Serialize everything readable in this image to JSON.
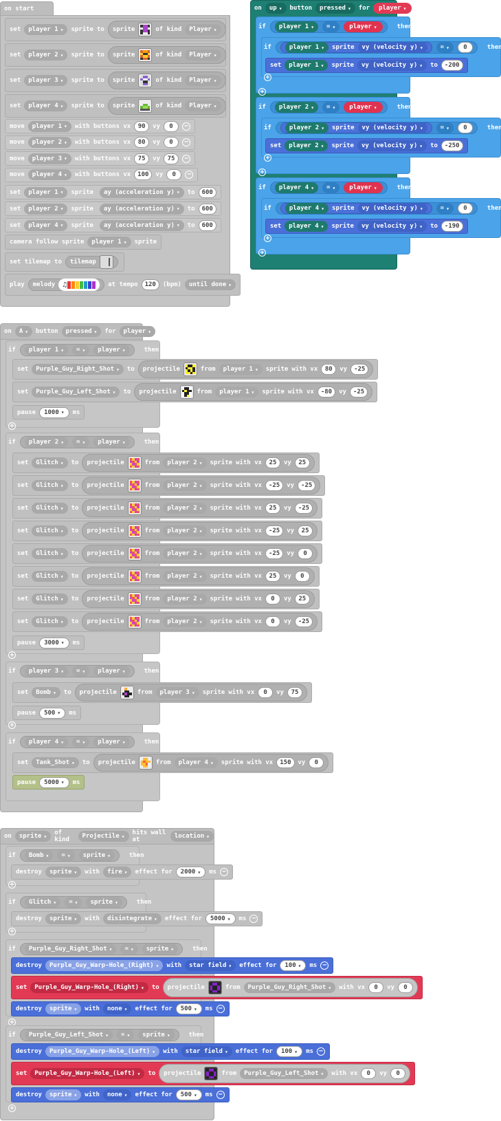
{
  "kw": {
    "set": "set",
    "sprite": "sprite",
    "to": "to",
    "of_kind": "of kind",
    "move": "move",
    "with_buttons_vx": "with buttons vx",
    "vy": "vy",
    "camera_follow": "camera follow sprite",
    "set_tilemap": "set tilemap to",
    "tilemap": "tilemap",
    "play": "play",
    "melody": "melody",
    "at_tempo": "at tempo",
    "bpm": "(bpm)",
    "if": "if",
    "then": "then",
    "for": "for",
    "projectile": "projectile",
    "from": "from",
    "with_vx": "with vx",
    "pause": "pause",
    "ms": "ms",
    "on": "on",
    "button": "button",
    "destroy": "destroy",
    "with": "with",
    "effect_for": "effect for",
    "effect": "effect",
    "hits_wall_at": "hits wall at",
    "location": "location",
    "eq": "="
  },
  "on_start": {
    "title": "on start",
    "set_rows": [
      {
        "player": "player 1",
        "kind": "Player"
      },
      {
        "player": "player 2",
        "kind": "Player"
      },
      {
        "player": "player 3",
        "kind": "Player"
      },
      {
        "player": "player 4",
        "kind": "Player"
      }
    ],
    "move_rows": [
      {
        "player": "player 1",
        "vx": "90",
        "vy": "0"
      },
      {
        "player": "player 2",
        "vx": "80",
        "vy": "0"
      },
      {
        "player": "player 3",
        "vx": "75",
        "vy": "75"
      },
      {
        "player": "player 4",
        "vx": "100",
        "vy": "0"
      }
    ],
    "accel_rows": [
      {
        "player": "player 1",
        "prop": "ay (acceleration y)",
        "val": "600"
      },
      {
        "player": "player 2",
        "prop": "ay (acceleration y)",
        "val": "600"
      },
      {
        "player": "player 4",
        "prop": "ay (acceleration y)",
        "val": "600"
      }
    ],
    "camera_player": "player 1",
    "tempo": "120",
    "until": "until done"
  },
  "on_up": {
    "key": "up",
    "pressed": "pressed",
    "player": "player",
    "blocks": [
      {
        "p": "player 1",
        "vyprop": "vy (velocity y)",
        "zero": "0",
        "val": "-200"
      },
      {
        "p": "player 2",
        "vyprop": "vy (velocity y)",
        "zero": "0",
        "val": "-250"
      },
      {
        "p": "player 4",
        "vyprop": "vy (velocity y)",
        "zero": "0",
        "val": "-190"
      }
    ]
  },
  "on_a": {
    "key": "A",
    "pressed": "pressed",
    "player": "player",
    "p1": {
      "player": "player 1",
      "shots": [
        {
          "var": "Purple_Guy_Right_Shot",
          "vx": "80",
          "vy": "-25"
        },
        {
          "var": "Purple_Guy_Left_Shot",
          "vx": "-80",
          "vy": "-25"
        }
      ],
      "pause": "1000"
    },
    "p2": {
      "player": "player 2",
      "var": "Glitch",
      "shots": [
        {
          "vx": "25",
          "vy": "25"
        },
        {
          "vx": "-25",
          "vy": "-25"
        },
        {
          "vx": "25",
          "vy": "-25"
        },
        {
          "vx": "-25",
          "vy": "25"
        },
        {
          "vx": "-25",
          "vy": "0"
        },
        {
          "vx": "25",
          "vy": "0"
        },
        {
          "vx": "0",
          "vy": "25"
        },
        {
          "vx": "0",
          "vy": "-25"
        }
      ],
      "pause": "3000"
    },
    "p3": {
      "player": "player 3",
      "var": "Bomb",
      "vx": "0",
      "vy": "75",
      "pause": "500"
    },
    "p4": {
      "player": "player 4",
      "var": "Tank_Shot",
      "vx": "150",
      "vy": "0",
      "pause": "5000"
    }
  },
  "on_wall": {
    "sprite": "sprite",
    "kind": "Projectile",
    "bomb": {
      "var": "Bomb",
      "effect": "fire",
      "ms": "2000"
    },
    "glitch": {
      "var": "Glitch",
      "effect": "disintegrate",
      "ms": "5000"
    },
    "right": {
      "var": "Purple_Guy_Right_Shot",
      "hole": "Purple_Guy_Warp-Hole_(Right)",
      "effect": "star field",
      "ms": "100",
      "vx": "0",
      "vy": "0",
      "effect2": "none",
      "ms2": "500"
    },
    "left": {
      "var": "Purple_Guy_Left_Shot",
      "hole": "Purple_Guy_Warp-Hole_(Left)",
      "effect": "star field",
      "ms": "100",
      "vx": "0",
      "vy": "0",
      "effect2": "none",
      "ms2": "500"
    }
  }
}
